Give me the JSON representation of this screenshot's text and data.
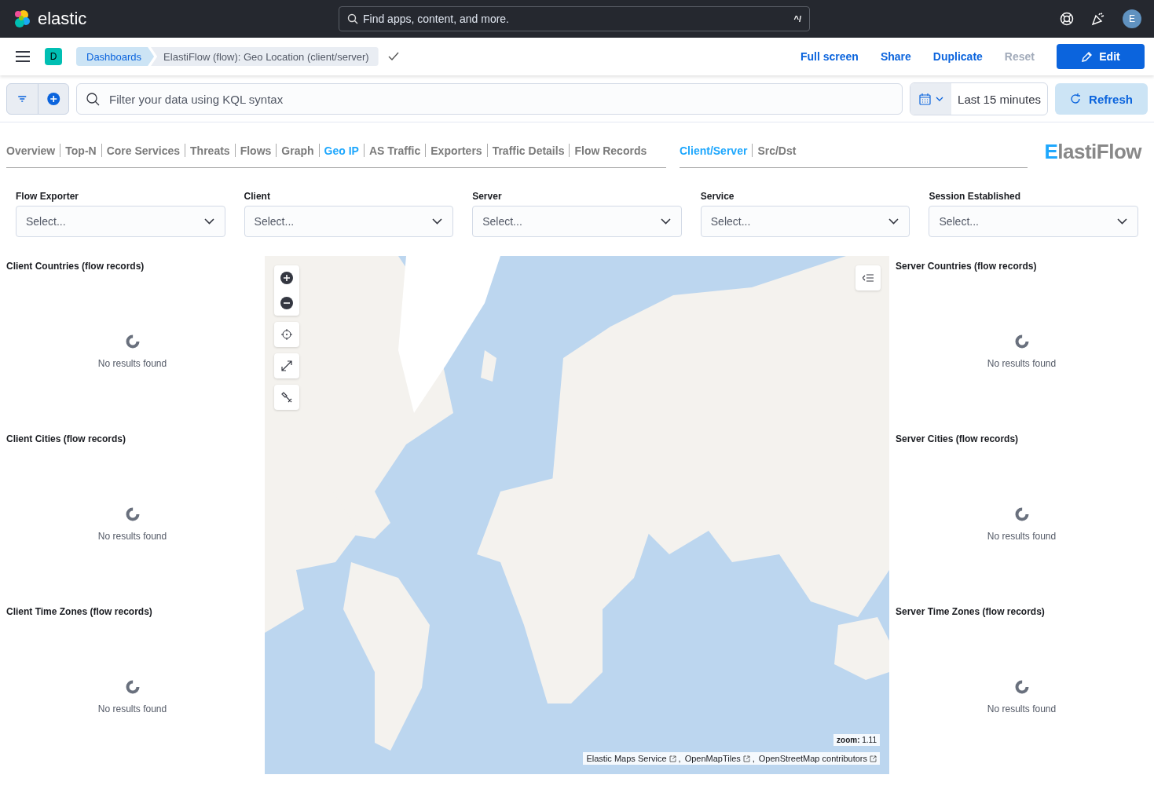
{
  "header": {
    "logo_text": "elastic",
    "search_placeholder": "Find apps, content, and more.",
    "shortcut": "^/",
    "avatar": "E"
  },
  "toolbar": {
    "space_badge": "D",
    "breadcrumbs": [
      {
        "label": "Dashboards",
        "selected": false
      },
      {
        "label": "ElastiFlow (flow): Geo Location (client/server)",
        "selected": true
      }
    ],
    "actions": [
      {
        "label": "Full screen",
        "kind": "link"
      },
      {
        "label": "Share",
        "kind": "link"
      },
      {
        "label": "Duplicate",
        "kind": "link"
      },
      {
        "label": "Reset",
        "kind": "disabled"
      },
      {
        "label": "Edit",
        "kind": "primary"
      }
    ]
  },
  "filter_bar": {
    "query_placeholder": "Filter your data using KQL syntax",
    "time_range": "Last 15 minutes",
    "refresh": "Refresh"
  },
  "nav": {
    "groups": [
      [
        {
          "label": "Overview",
          "selected": false
        },
        {
          "label": "Top-N",
          "selected": false
        },
        {
          "label": "Core Services",
          "selected": false
        },
        {
          "label": "Threats",
          "selected": false
        },
        {
          "label": "Flows",
          "selected": false
        },
        {
          "label": "Graph",
          "selected": false
        },
        {
          "label": "Geo IP",
          "selected": true
        },
        {
          "label": "AS Traffic",
          "selected": false
        },
        {
          "label": "Exporters",
          "selected": false
        },
        {
          "label": "Traffic Details",
          "selected": false
        },
        {
          "label": "Flow Records",
          "selected": false
        }
      ],
      [
        {
          "label": "Client/Server",
          "selected": true
        },
        {
          "label": "Src/Dst",
          "selected": false
        }
      ]
    ],
    "logo": "ElastiFlow"
  },
  "controls": [
    {
      "label": "Flow Exporter",
      "placeholder": "Select..."
    },
    {
      "label": "Client",
      "placeholder": "Select..."
    },
    {
      "label": "Server",
      "placeholder": "Select..."
    },
    {
      "label": "Service",
      "placeholder": "Select..."
    },
    {
      "label": "Session Established",
      "placeholder": "Select..."
    }
  ],
  "left_panels": [
    {
      "title": "Client Countries (flow records)",
      "message": "No results found"
    },
    {
      "title": "Client Cities (flow records)",
      "message": "No results found"
    },
    {
      "title": "Client Time Zones (flow records)",
      "message": "No results found"
    }
  ],
  "map": {
    "zoom": "**zoom:** 1.11",
    "attribution": [
      {
        "label": "Elastic Maps Service",
        "suffix": ","
      },
      {
        "label": "OpenMapTiles",
        "suffix": ","
      },
      {
        "label": "OpenStreetMap contributors"
      }
    ]
  },
  "right_panels": [
    {
      "title": "Server Countries (flow records)",
      "message": "No results found"
    },
    {
      "title": "Server Cities (flow records)",
      "message": "No results found"
    },
    {
      "title": "Server Time Zones (flow records)",
      "message": "No results found"
    }
  ]
}
